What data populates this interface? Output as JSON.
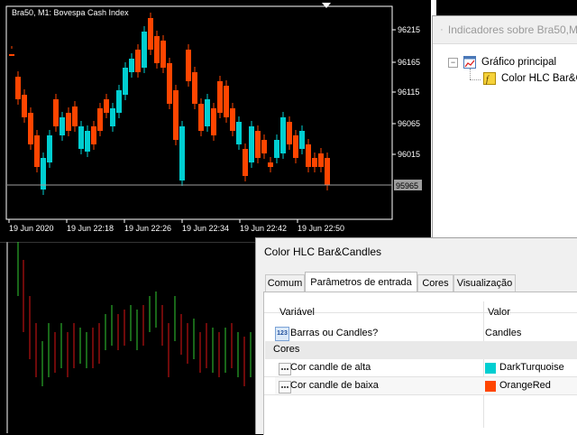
{
  "chart": {
    "caption": "Bra50, M1:  Bovespa Cash Index",
    "price_labels": [
      "96215",
      "96165",
      "96115",
      "96065",
      "96015"
    ],
    "current_price": "95965",
    "time_labels": [
      "19 Jun 2020",
      "19 Jun 22:18",
      "19 Jun 22:26",
      "19 Jun 22:34",
      "19 Jun 22:42",
      "19 Jun 22:50"
    ],
    "colors": {
      "bull": "#00CED1",
      "bear": "#FF4500",
      "grid_line": "#9E9E9E",
      "background": "#000000",
      "bar_up": "#32CD32",
      "bar_down": "#DC1414"
    }
  },
  "indicators_window": {
    "title": "Indicadores sobre Bra50,M",
    "tree": {
      "root": "Gráfico principal",
      "child": "Color HLC Bar&Ca"
    }
  },
  "dialog": {
    "title": "Color HLC Bar&Candles",
    "tabs": [
      "Comum",
      "Parâmetros de entrada",
      "Cores",
      "Visualização"
    ],
    "active_tab": "Parâmetros de entrada",
    "columns": {
      "variable": "Variável",
      "value": "Valor"
    },
    "rows": {
      "bars_or_candles": {
        "name": "Barras ou Candles?",
        "value": "Candles"
      },
      "group": {
        "name": "Cores"
      },
      "bull_color": {
        "name": "Cor candle de alta",
        "value": "DarkTurquoise",
        "color": "#00CED1"
      },
      "bear_color": {
        "name": "Cor candle de baixa",
        "value": "OrangeRed",
        "color": "#FF4500"
      }
    }
  }
}
